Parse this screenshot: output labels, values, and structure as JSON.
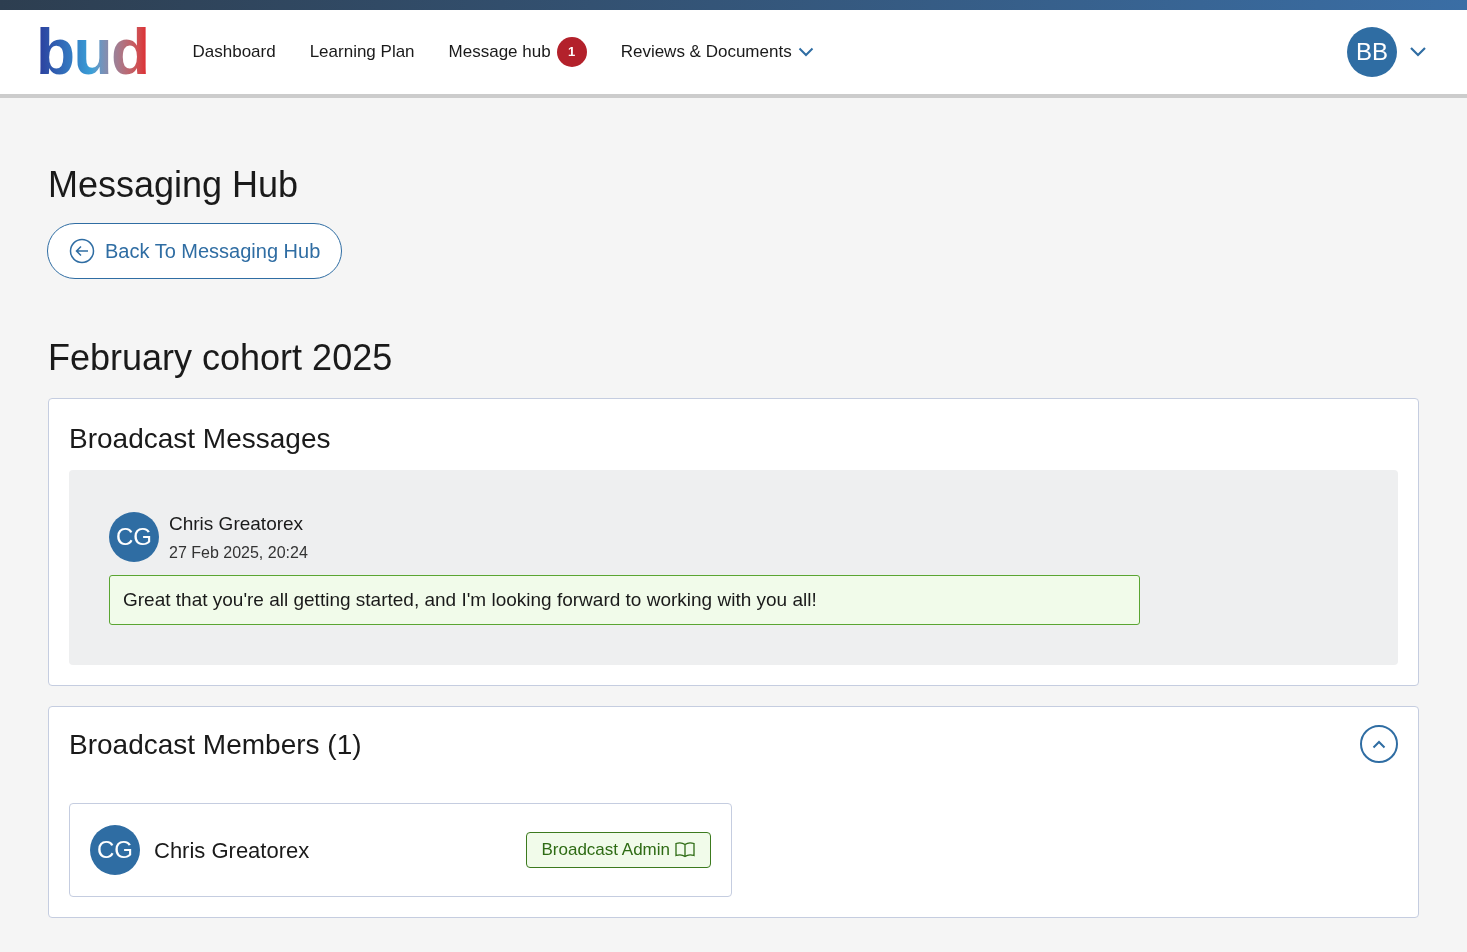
{
  "header": {
    "logo": "bud",
    "nav": [
      {
        "label": "Dashboard",
        "dropdown": false
      },
      {
        "label": "Learning Plan",
        "dropdown": false
      },
      {
        "label": "Message hub",
        "badge": "1",
        "dropdown": false
      },
      {
        "label": "Reviews & Documents",
        "dropdown": true
      }
    ],
    "user_initials": "BB"
  },
  "page_title": "Messaging Hub",
  "back_button": "Back To Messaging Hub",
  "group_title": "February cohort 2025",
  "messages_panel": {
    "title": "Broadcast Messages",
    "messages": [
      {
        "initials": "CG",
        "author": "Chris Greatorex",
        "time": "27 Feb 2025, 20:24",
        "text": "Great that you're all getting started, and I'm looking forward to working with you all!"
      }
    ]
  },
  "members_panel": {
    "title": "Broadcast Members (1)",
    "expanded": true,
    "members": [
      {
        "initials": "CG",
        "name": "Chris Greatorex",
        "role": "Broadcast Admin"
      }
    ]
  }
}
